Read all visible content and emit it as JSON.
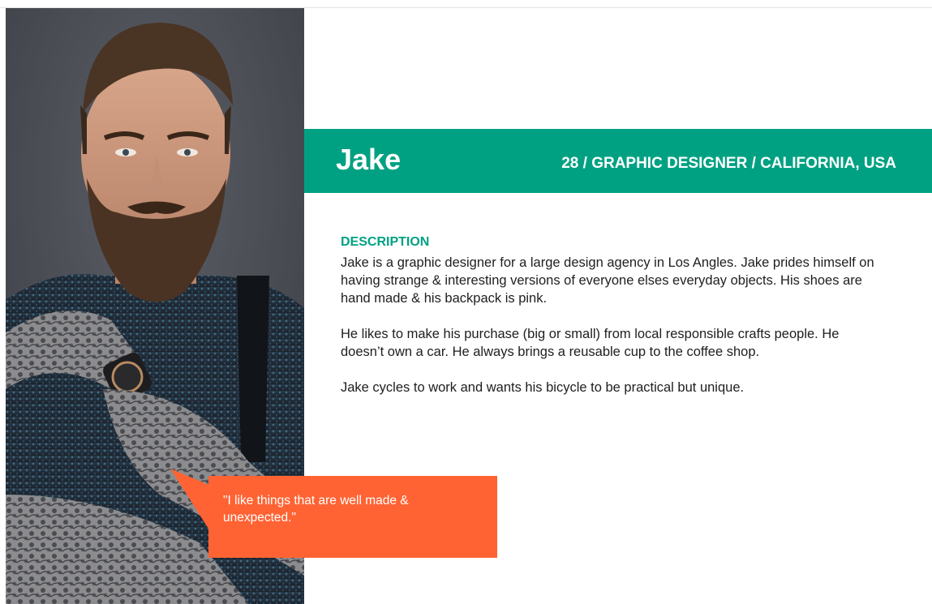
{
  "persona": {
    "name": "Jake",
    "meta": "28 / GRAPHIC DESIGNER / CALIFORNIA, USA"
  },
  "description": {
    "heading": "DESCRIPTION",
    "paragraphs": [
      "Jake is a graphic designer for a large design agency in Los Angles. Jake prides himself on having strange & interesting versions of everyone elses everyday objects. His shoes are hand made & his backpack is pink.",
      "He likes to make his purchase (big or small) from local responsible crafts people. He doesn’t own a car. He always brings a reusable cup to the coffee shop.",
      "Jake cycles to work and wants his bicycle to be practical but unique."
    ]
  },
  "quote": {
    "text": "\"I like things that are well made & unexpected.\""
  },
  "colors": {
    "accent": "#00a182",
    "quote_background": "#ff6333",
    "body_text": "#1e1e1e",
    "photo_background": "#4d5058"
  },
  "photo": {
    "subject": "persona-portrait-icon"
  }
}
